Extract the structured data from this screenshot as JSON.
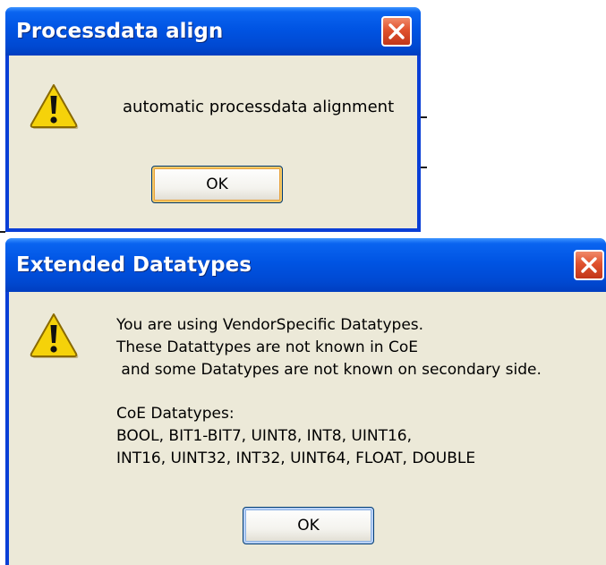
{
  "dialog1": {
    "title": "Processdata align",
    "message": "automatic processdata alignment",
    "ok_label": "OK",
    "icon": "warning-icon",
    "close_icon": "close-icon"
  },
  "dialog2": {
    "title": "Extended Datatypes",
    "message_lines": [
      "You are using VendorSpecific Datatypes.",
      "These Datattypes are not known in CoE",
      " and some Datatypes are not known on secondary side.",
      "",
      "CoE Datatypes:",
      "BOOL, BIT1-BIT7, UINT8, INT8, UINT16,",
      "INT16, UINT32, INT32, UINT64, FLOAT, DOUBLE"
    ],
    "ok_label": "OK",
    "icon": "warning-icon",
    "close_icon": "close-icon"
  },
  "colors": {
    "title_bar": "#0054e3",
    "frame": "#0a3fd6",
    "client": "#ece9d8",
    "close_button": "#e0522e",
    "warning": "#f5d20a"
  }
}
